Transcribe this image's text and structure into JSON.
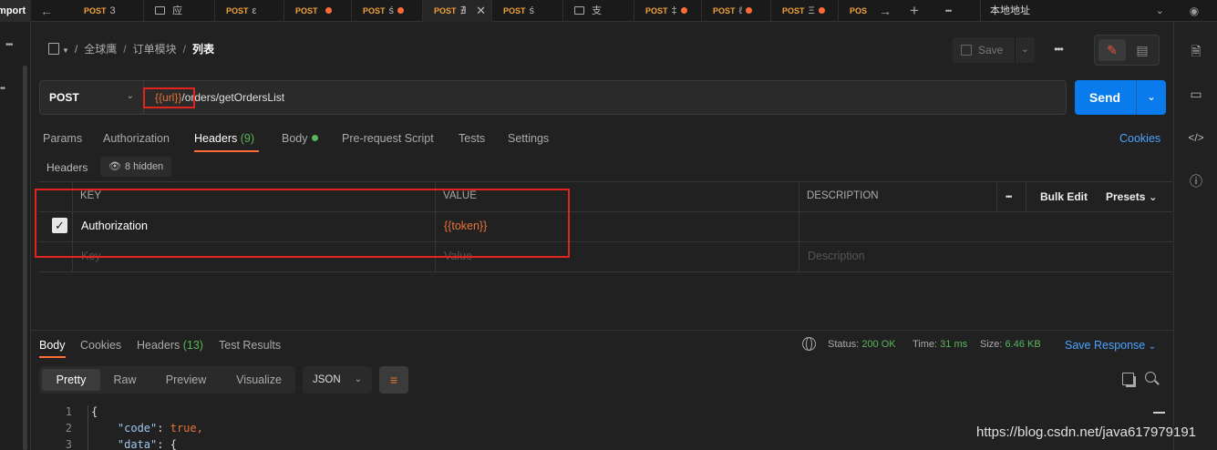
{
  "tab_bar": {
    "import_label": "Import",
    "tabs": [
      {
        "method": "POST",
        "name": "3",
        "unsaved": false,
        "folder": false
      },
      {
        "method": "",
        "name": "应",
        "unsaved": false,
        "folder": true
      },
      {
        "method": "POST",
        "name": "ε",
        "unsaved": false,
        "folder": false
      },
      {
        "method": "POST",
        "name": "",
        "unsaved": true,
        "folder": false
      },
      {
        "method": "POST",
        "name": "ś",
        "unsaved": true,
        "folder": false
      },
      {
        "method": "POST",
        "name": "∄",
        "unsaved": false,
        "folder": false,
        "active": true
      },
      {
        "method": "POST",
        "name": "ś",
        "unsaved": false,
        "folder": false
      },
      {
        "method": "",
        "name": "支",
        "unsaved": false,
        "folder": true
      },
      {
        "method": "POST",
        "name": "‡",
        "unsaved": true,
        "folder": false
      },
      {
        "method": "POST",
        "name": "ℓ",
        "unsaved": true,
        "folder": false
      },
      {
        "method": "POST",
        "name": "Ξ",
        "unsaved": true,
        "folder": false
      },
      {
        "method": "POS",
        "name": "",
        "unsaved": false,
        "folder": false
      }
    ],
    "environment": "本地地址",
    "close_glyph": "✕",
    "back_glyph": "←",
    "forward_glyph": "→",
    "add_glyph": "+",
    "more_glyph": "•••",
    "eye_glyph": "◉"
  },
  "breadcrumb": {
    "items": [
      "全球鹰",
      "订单模块"
    ],
    "current": "列表",
    "separator": "/"
  },
  "toolbar": {
    "save_label": "Save",
    "more_glyph": "•••"
  },
  "request": {
    "method": "POST",
    "url_variable": "{{url}}",
    "url_path": "/orders/getOrdersList",
    "send_label": "Send"
  },
  "request_tabs": {
    "params": "Params",
    "authorization": "Authorization",
    "headers": "Headers",
    "headers_count": "(9)",
    "body": "Body",
    "prerequest": "Pre-request Script",
    "tests": "Tests",
    "settings": "Settings",
    "cookies": "Cookies"
  },
  "headers_section": {
    "title": "Headers",
    "hidden_label": "8 hidden",
    "columns": {
      "key": "KEY",
      "value": "VALUE",
      "description": "DESCRIPTION"
    },
    "bulk_edit": "Bulk Edit",
    "presets": "Presets",
    "more_glyph": "•••",
    "rows": [
      {
        "checked": true,
        "key": "Authorization",
        "value": "{{token}}",
        "description": ""
      }
    ],
    "placeholders": {
      "key": "Key",
      "value": "Value",
      "description": "Description"
    }
  },
  "response": {
    "tabs": {
      "body": "Body",
      "cookies": "Cookies",
      "headers": "Headers",
      "headers_count": "(13)",
      "test_results": "Test Results"
    },
    "status_label": "Status:",
    "status_value": "200 OK",
    "time_label": "Time:",
    "time_value": "31 ms",
    "size_label": "Size:",
    "size_value": "6.46 KB",
    "save_response": "Save Response",
    "views": [
      "Pretty",
      "Raw",
      "Preview",
      "Visualize"
    ],
    "active_view": "Pretty",
    "format": "JSON",
    "code_lines": [
      {
        "n": "1",
        "indent": "",
        "key": "",
        "text": "{"
      },
      {
        "n": "2",
        "indent": "    ",
        "key": "\"code\"",
        "text": ": ",
        "value": "true,"
      },
      {
        "n": "3",
        "indent": "    ",
        "key": "\"data\"",
        "text": ": {"
      }
    ]
  },
  "watermark": "https://blog.csdn.net/java617979191",
  "colors": {
    "accent_orange": "#ff6c37",
    "send_blue": "#097bed",
    "link_blue": "#4aa3ff",
    "success_green": "#59b65b",
    "annotation_red": "#e3231d"
  }
}
